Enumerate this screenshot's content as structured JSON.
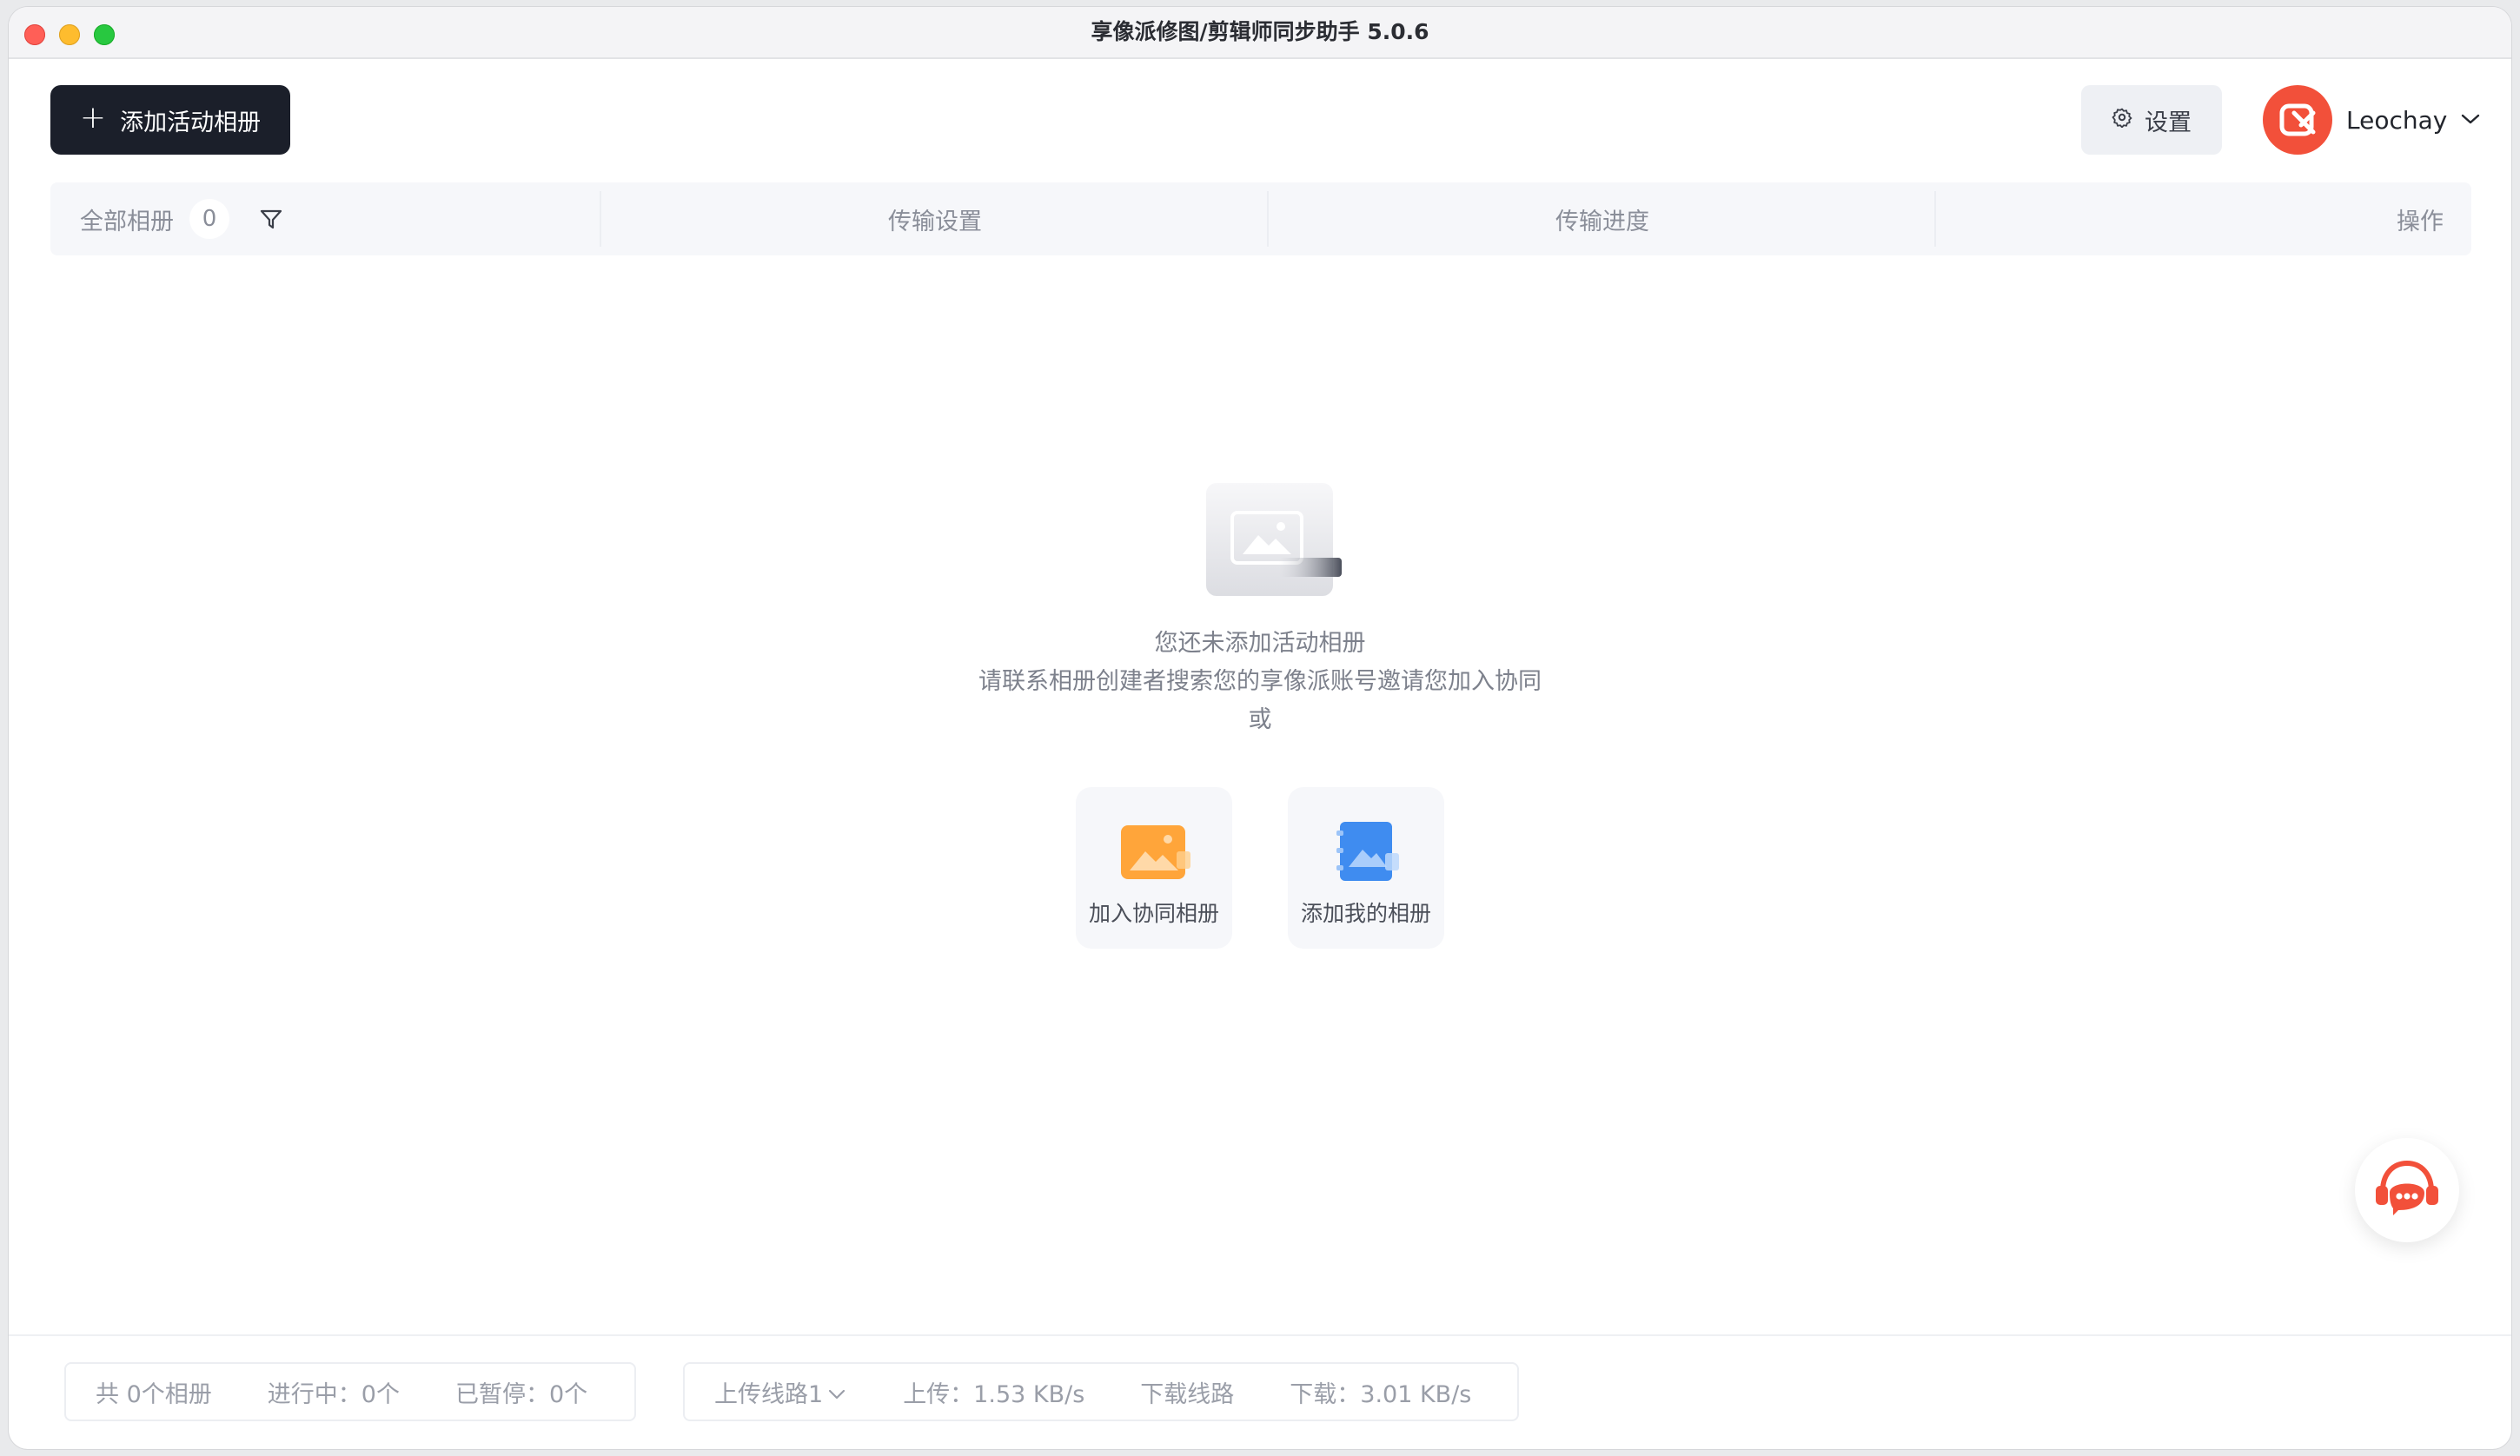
{
  "window": {
    "title": "享像派修图/剪辑师同步助手 5.0.6"
  },
  "toolbar": {
    "add_album_label": "添加活动相册",
    "settings_label": "设置",
    "username": "Leochay"
  },
  "table": {
    "all_albums_label": "全部相册",
    "album_count": "0",
    "col_transfer_settings": "传输设置",
    "col_transfer_progress": "传输进度",
    "col_actions": "操作"
  },
  "empty_state": {
    "line1": "您还未添加活动相册",
    "line2": "请联系相册创建者搜索您的享像派账号邀请您加入协同",
    "line3": "或",
    "join_card_label": "加入协同相册",
    "add_card_label": "添加我的相册"
  },
  "footer": {
    "total": "共 0个相册",
    "in_progress": "进行中：0个",
    "paused": "已暂停：0个",
    "upload_route": "上传线路1",
    "upload_speed": "上传：1.53 KB/s",
    "download_route": "下载线路",
    "download_speed": "下载：3.01 KB/s"
  },
  "colors": {
    "primary_dark": "#1b1f2a",
    "brand_red": "#f2503a",
    "join_icon": "#ffa53a",
    "add_icon": "#3f8cf0"
  },
  "icons": [
    "plus-icon",
    "gear-icon",
    "brand-avatar-icon",
    "chevron-down-icon",
    "filter-icon",
    "empty-album-illustration",
    "join-album-icon",
    "add-album-icon",
    "customer-support-icon"
  ]
}
